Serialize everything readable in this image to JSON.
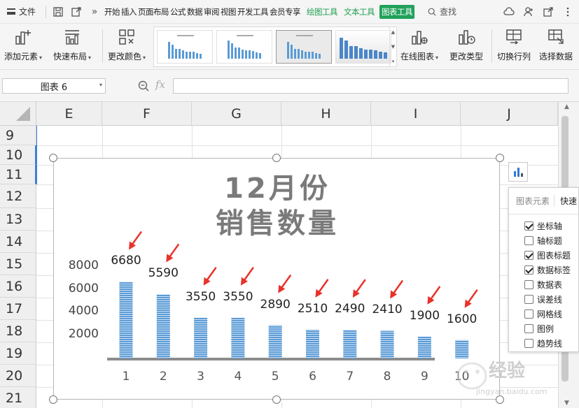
{
  "menubar": {
    "file_label": "文件",
    "tabs": [
      "开始",
      "插入",
      "页面布局",
      "公式",
      "数据",
      "审阅",
      "视图",
      "开发工具",
      "会员专享"
    ],
    "context_tabs": [
      "绘图工具",
      "文本工具"
    ],
    "active_tab": "图表工具",
    "search_label": "查找"
  },
  "ribbon": {
    "add_element": "添加元素",
    "quick_layout": "快速布局",
    "change_color": "更改颜色",
    "online_chart": "在线图表",
    "change_type": "更改类型",
    "switch_row_col": "切换行列",
    "select_data": "选择数据"
  },
  "formula_bar": {
    "name_box": "图表 6",
    "fx_label": "fx",
    "formula_value": ""
  },
  "grid": {
    "columns": [
      "E",
      "F",
      "G",
      "H",
      "I",
      "J"
    ],
    "rows": [
      "9",
      "10",
      "11",
      "12",
      "13",
      "14",
      "15",
      "16",
      "17",
      "18",
      "19",
      "20",
      "21"
    ]
  },
  "chart_data": {
    "type": "bar",
    "title_line1": "12月份",
    "title_line2": "销售数量",
    "categories": [
      "1",
      "2",
      "3",
      "4",
      "5",
      "6",
      "7",
      "8",
      "9",
      "10"
    ],
    "values": [
      6680,
      5590,
      3550,
      3550,
      2890,
      2510,
      2490,
      2410,
      1900,
      1600
    ],
    "y_ticks": [
      "8000",
      "6000",
      "4000",
      "2000"
    ],
    "ylim": [
      0,
      8000
    ],
    "grid": false,
    "bar_color": "#5b9bd5",
    "arrow_color": "#e8322a"
  },
  "chart_panel": {
    "tabs": [
      "图表元素",
      "快速"
    ],
    "items": [
      {
        "label": "坐标轴",
        "checked": true
      },
      {
        "label": "轴标题",
        "checked": false
      },
      {
        "label": "图表标题",
        "checked": true
      },
      {
        "label": "数据标签",
        "checked": true
      },
      {
        "label": "数据表",
        "checked": false
      },
      {
        "label": "误差线",
        "checked": false
      },
      {
        "label": "网格线",
        "checked": false
      },
      {
        "label": "图例",
        "checked": false
      },
      {
        "label": "趋势线",
        "checked": false
      }
    ]
  },
  "watermark": {
    "text": "经验",
    "sub": "jingyan.baidu.com"
  }
}
